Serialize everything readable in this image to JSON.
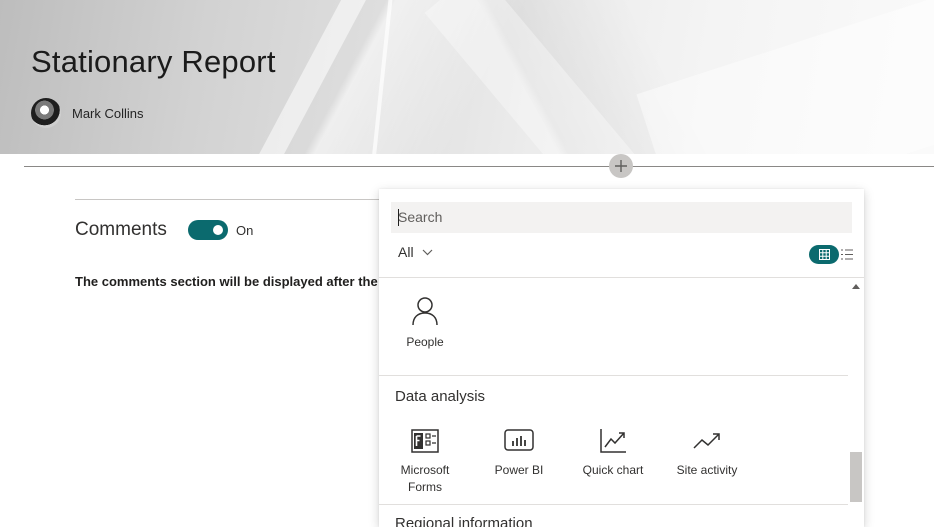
{
  "page": {
    "title": "Stationary Report",
    "author": "Mark Collins"
  },
  "comments": {
    "heading": "Comments",
    "toggle_state": "On",
    "note": "The comments section will be displayed after the page is published."
  },
  "toolbox": {
    "search_placeholder": "Search",
    "filter_label": "All",
    "people_tile": {
      "label": "People",
      "icon": "person-icon"
    },
    "groups": [
      {
        "title": "Data analysis",
        "items": [
          {
            "label": "Microsoft Forms",
            "icon": "microsoft-forms-icon"
          },
          {
            "label": "Power BI",
            "icon": "power-bi-icon"
          },
          {
            "label": "Quick chart",
            "icon": "quick-chart-icon"
          },
          {
            "label": "Site activity",
            "icon": "site-activity-icon"
          }
        ]
      },
      {
        "title": "Regional information",
        "items": []
      }
    ]
  },
  "colors": {
    "accent": "#0b6a6e",
    "text": "#323130",
    "divider": "#e1dfdd"
  }
}
